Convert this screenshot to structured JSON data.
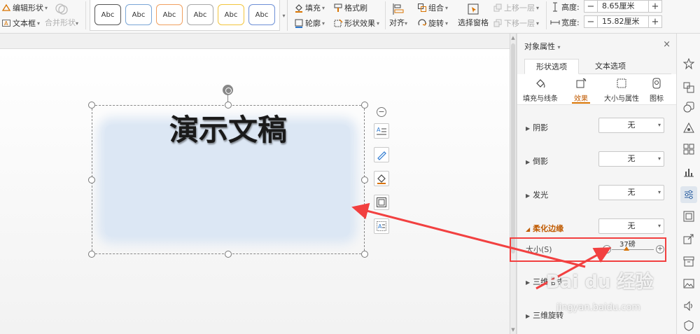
{
  "ribbon": {
    "edit_shape": "编辑形状",
    "text_box": "文本框",
    "merge_shape": "合并形状",
    "style_samples": [
      "Abc",
      "Abc",
      "Abc",
      "Abc",
      "Abc",
      "Abc"
    ],
    "fill": "填充",
    "format_painter": "格式刷",
    "outline": "轮廓",
    "shape_effects": "形状效果",
    "align": "对齐",
    "group": "组合",
    "rotate": "旋转",
    "selection_pane": "选择窗格",
    "bring_forward": "上移一层",
    "send_backward": "下移一层",
    "height_label": "高度:",
    "height_value": "8.65厘米",
    "width_label": "宽度:",
    "width_value": "15.82厘米"
  },
  "style_colors": [
    "#555555",
    "#7aa6d6",
    "#f0a060",
    "#a8a8a8",
    "#f2c53d",
    "#6d8fd6"
  ],
  "slide": {
    "title": "演示文稿"
  },
  "panel": {
    "title": "对象属性",
    "tabs": [
      "形状选项",
      "文本选项"
    ],
    "subtabs": [
      "填充与线条",
      "效果",
      "大小与属性",
      "图标"
    ],
    "sections": [
      {
        "label": "阴影",
        "value": "无"
      },
      {
        "label": "倒影",
        "value": "无"
      },
      {
        "label": "发光",
        "value": "无"
      },
      {
        "label": "柔化边缘",
        "value": "无"
      }
    ],
    "size_label": "大小(S)",
    "size_value": "37磅",
    "three_d_format": "三维格式",
    "three_d_rotation": "三维旋转"
  },
  "watermark": {
    "logo": "Bai du 经验",
    "url": "jingyan.baidu.com"
  },
  "accent_color": "#d87300",
  "annotation_color": "#f24040"
}
